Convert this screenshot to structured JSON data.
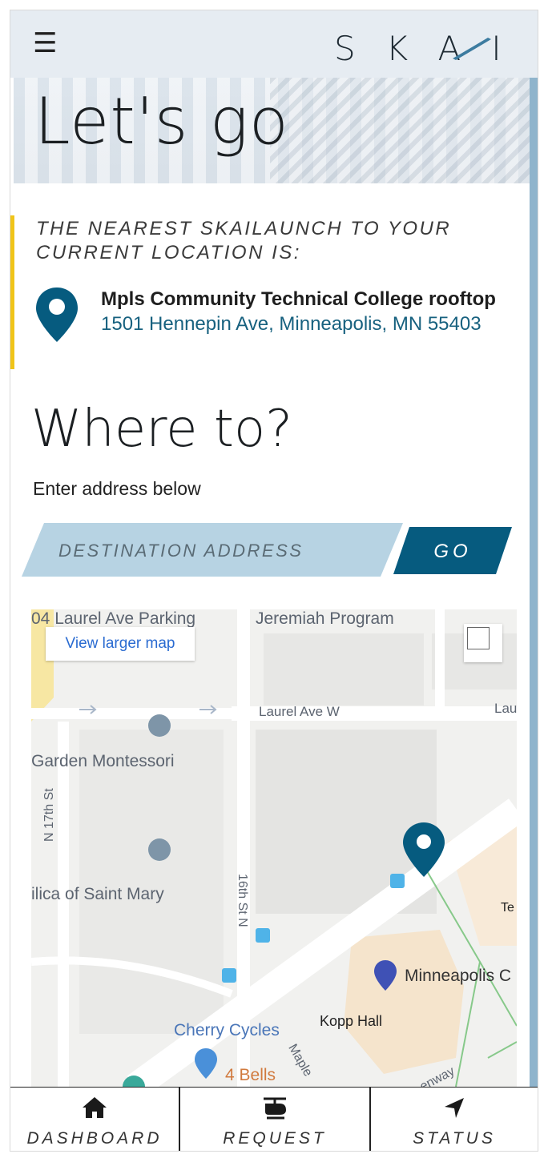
{
  "header": {
    "menu_icon": "hamburger-icon",
    "logo_text": "SKAI"
  },
  "hero": {
    "title": "Let's go"
  },
  "nearest": {
    "label": "THE NEAREST SKAILAUNCH TO YOUR CURRENT LOCATION IS:",
    "place_name": "Mpls Community Technical College rooftop",
    "place_address": "1501 Hennepin Ave, Minneapolis, MN 55403",
    "pin_color": "#065b7f"
  },
  "where": {
    "title": "Where to?",
    "hint": "Enter address below",
    "input_placeholder": "DESTINATION ADDRESS",
    "go_label": "GO"
  },
  "map": {
    "larger_map_link": "View larger map",
    "labels": {
      "laurel_parking": "04 Laurel Ave Parking",
      "jeremiah": "Jeremiah Program",
      "laurel_ave_w": "Laurel Ave W",
      "lau": "Lau",
      "garden_montessori": "Garden Montessori",
      "n17th": "N 17th St",
      "basilica": "ilica of Saint Mary",
      "16th": "16th St N",
      "te": "Te",
      "minneapolis_c": "Minneapolis C",
      "kopp_hall": "Kopp Hall",
      "cherry_cycles": "Cherry Cycles",
      "four_bells": "4 Bells",
      "maple": "Maple",
      "greenway": "enway"
    }
  },
  "bottom_nav": {
    "dashboard": "DASHBOARD",
    "request": "REQUEST",
    "status": "STATUS"
  },
  "colors": {
    "accent_yellow": "#f0c419",
    "brand_blue": "#065b7f",
    "input_bg": "#b7d3e3",
    "header_bg": "#e6ecf2"
  }
}
